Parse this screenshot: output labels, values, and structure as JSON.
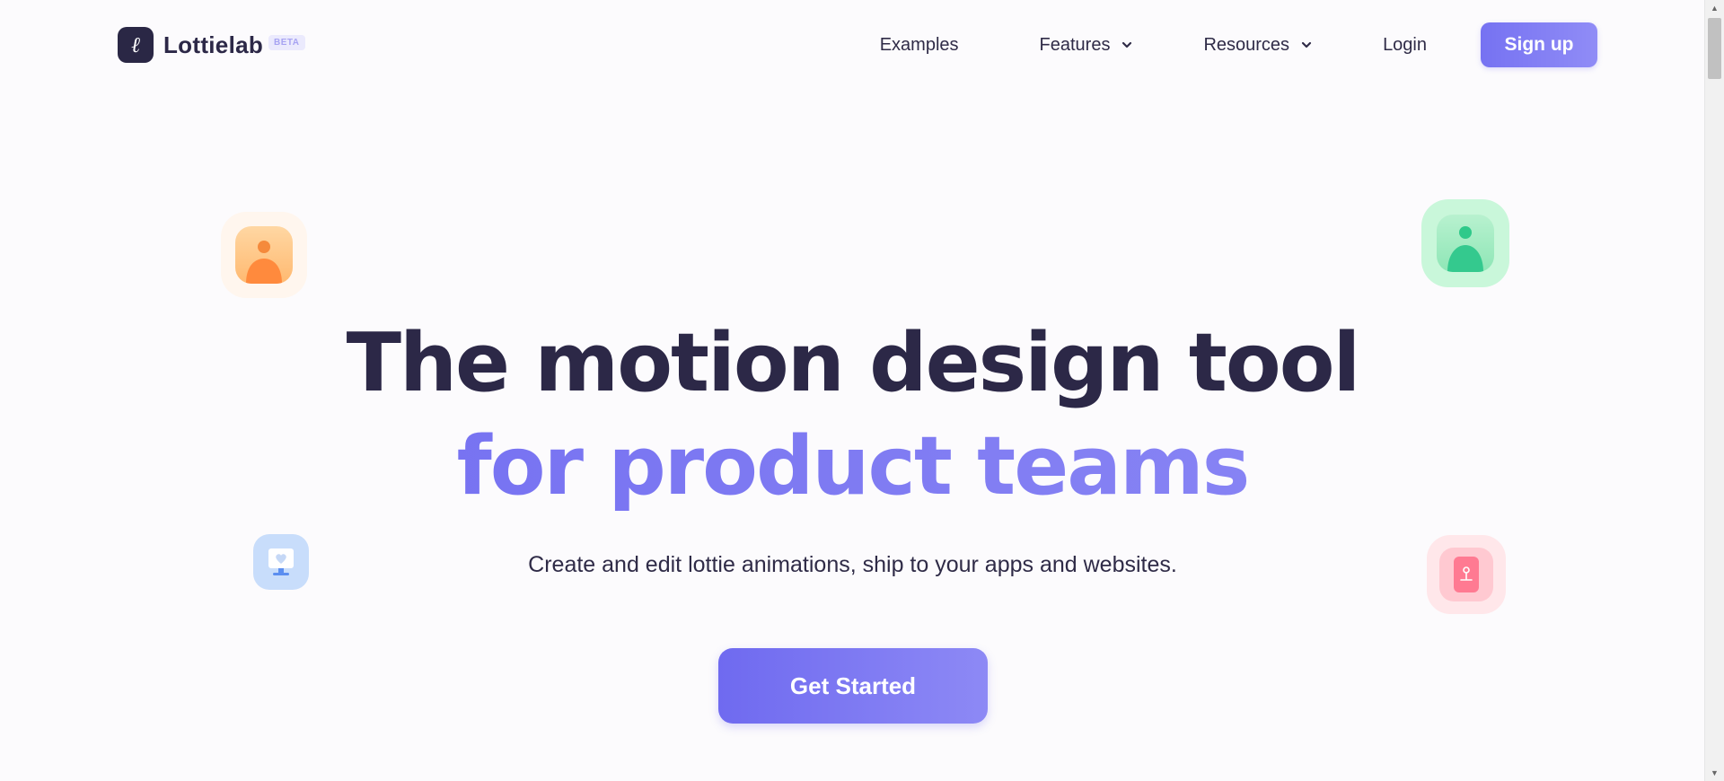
{
  "brand": {
    "name": "Lottielab",
    "badge": "BETA",
    "mark": "ℓ"
  },
  "nav": {
    "examples": "Examples",
    "features": "Features",
    "resources": "Resources",
    "login": "Login",
    "signup": "Sign up"
  },
  "hero": {
    "line1": "The motion design tool",
    "line2": "for product teams",
    "subtitle": "Create and edit lottie animations, ship to your apps and websites.",
    "cta": "Get Started"
  },
  "icons": {
    "orange": "user-avatar-icon",
    "green": "user-avatar-icon",
    "blue": "monitor-heart-icon",
    "pink": "phone-touch-icon"
  },
  "colors": {
    "accent": "#7672f2",
    "text": "#2c2847"
  }
}
